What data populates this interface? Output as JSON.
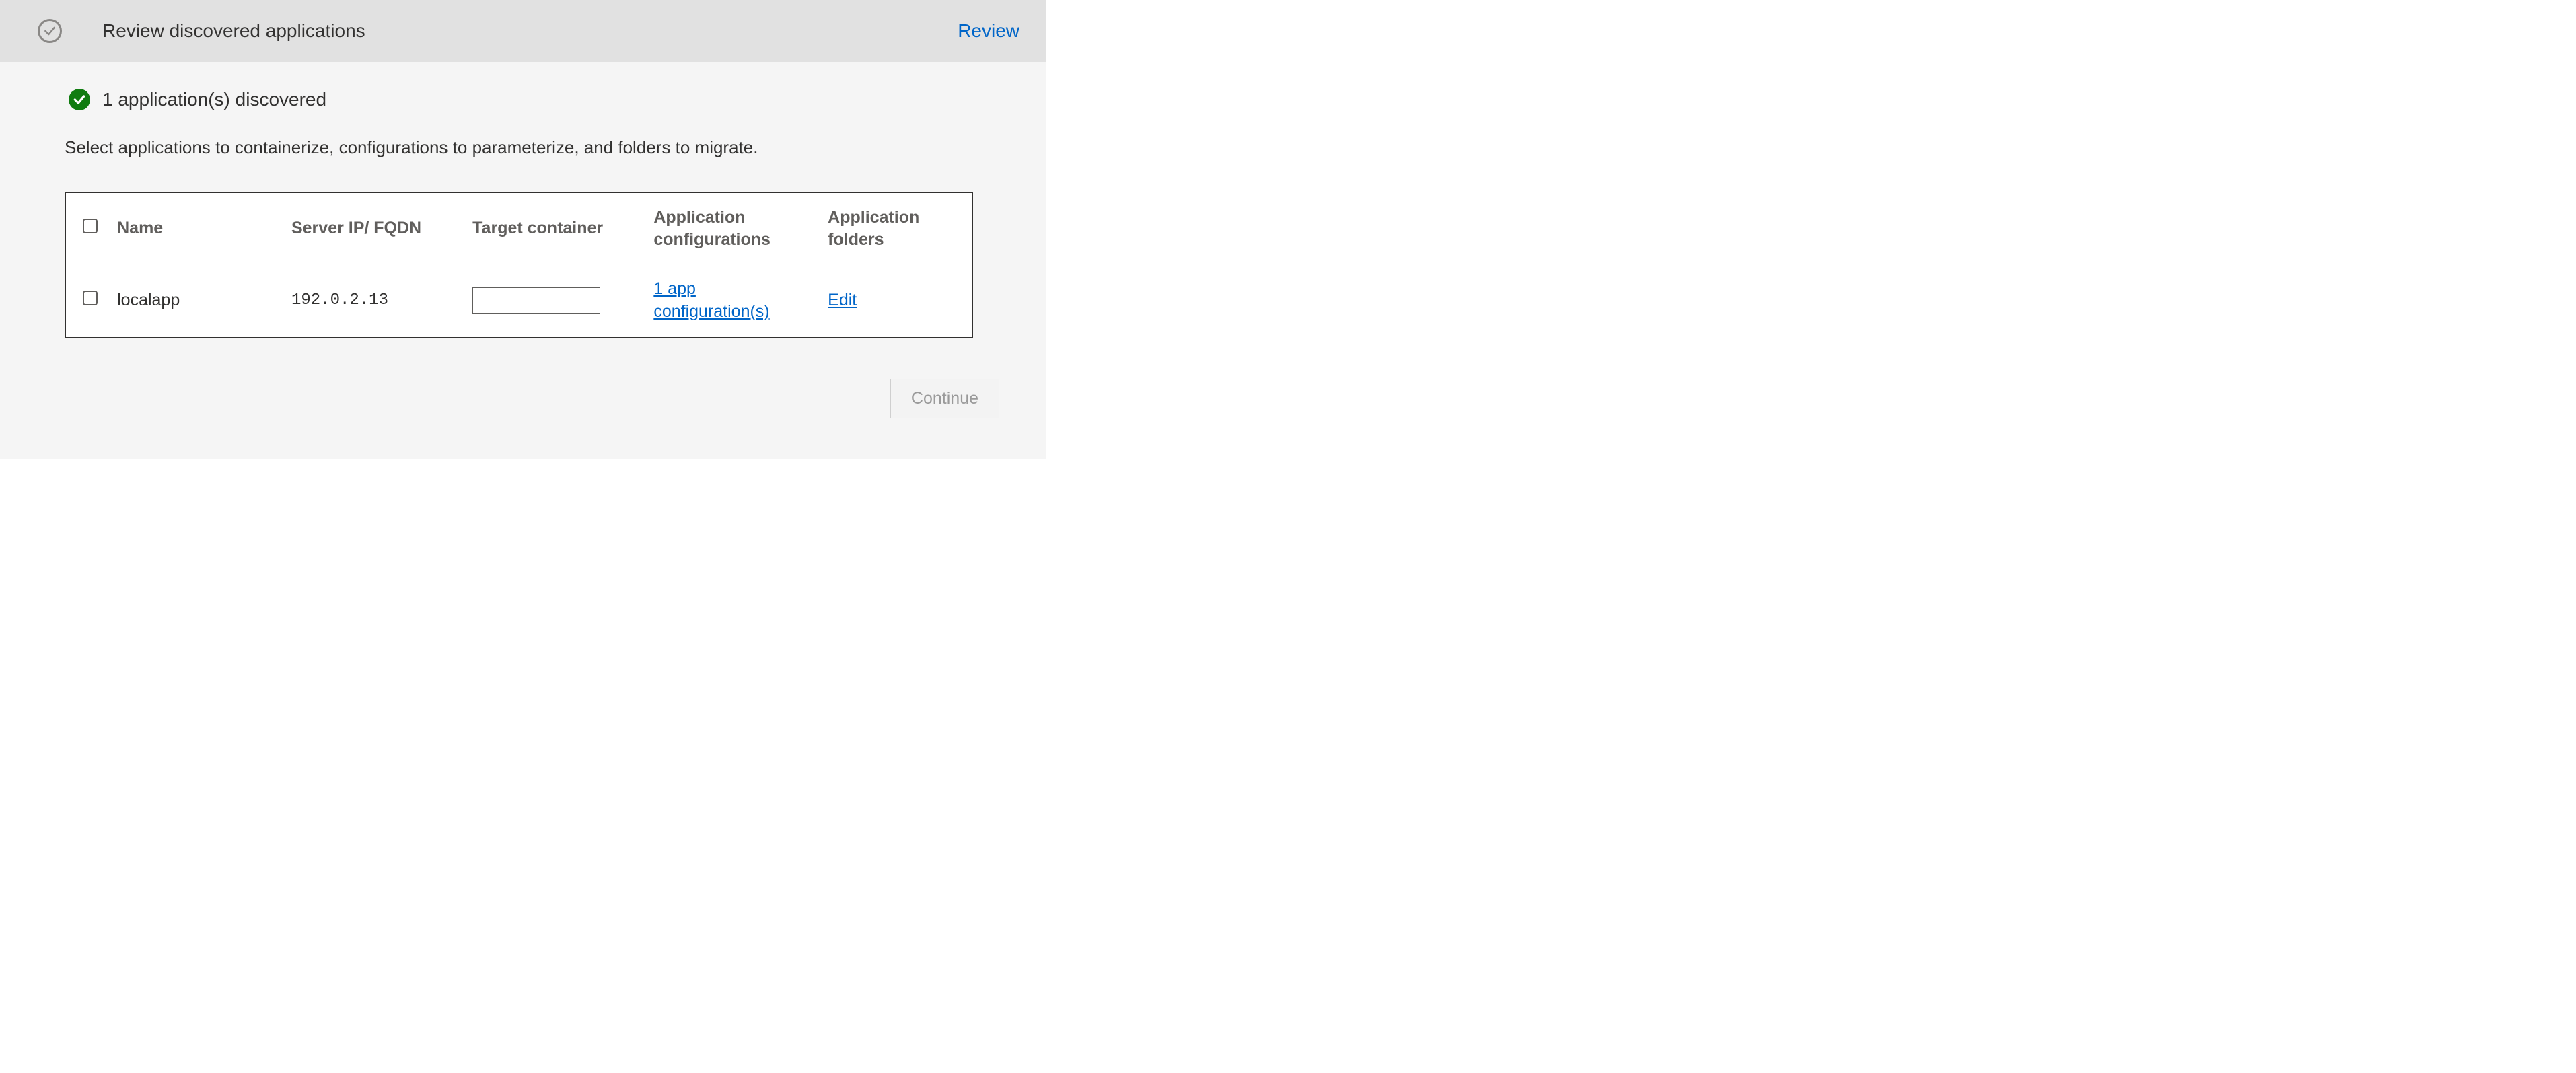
{
  "step": {
    "title": "Review discovered applications",
    "action_label": "Review"
  },
  "status": {
    "message": "1 application(s) discovered"
  },
  "instruction": "Select applications to containerize, configurations to parameterize, and folders to migrate.",
  "table": {
    "headers": {
      "name": "Name",
      "server": "Server IP/ FQDN",
      "target": "Target container",
      "config": "Application configurations",
      "folders": "Application folders"
    },
    "rows": [
      {
        "name": "localapp",
        "server": "192.0.2.13",
        "target": "",
        "config_link": "1 app configuration(s)",
        "folders_link": "Edit"
      }
    ]
  },
  "footer": {
    "continue_label": "Continue"
  }
}
